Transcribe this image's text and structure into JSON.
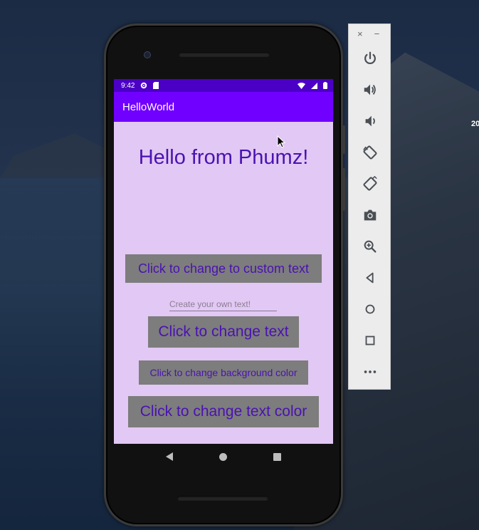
{
  "desktop": {
    "corner_text": "20"
  },
  "status_bar": {
    "time": "9:42",
    "icons": [
      "gear-icon",
      "sd-card-icon",
      "wifi-icon",
      "signal-icon",
      "battery-icon"
    ]
  },
  "app": {
    "title": "HelloWorld",
    "greeting": "Hello from Phumz!",
    "background_color": "#e2c8f4",
    "text_color": "#4a12b2",
    "appbar_color": "#7000ff",
    "statusbar_color": "#4b00c6"
  },
  "buttons": {
    "custom_text": "Click to change to custom text",
    "change_text": "Click to change text",
    "change_bg": "Click to change background color",
    "change_color": "Click to change text color"
  },
  "input": {
    "placeholder": "Create your own text!",
    "value": ""
  },
  "navigation": {
    "items": [
      "back-icon",
      "home-icon",
      "recents-icon"
    ]
  },
  "emulator_toolbar": {
    "window_controls": [
      "close-icon",
      "minimize-icon"
    ],
    "close_glyph": "×",
    "minimize_glyph": "−",
    "tools": [
      "power-icon",
      "volume-up-icon",
      "volume-down-icon",
      "rotate-left-icon",
      "rotate-right-icon",
      "camera-icon",
      "zoom-icon",
      "back-icon",
      "home-icon",
      "overview-icon",
      "more-icon"
    ]
  }
}
